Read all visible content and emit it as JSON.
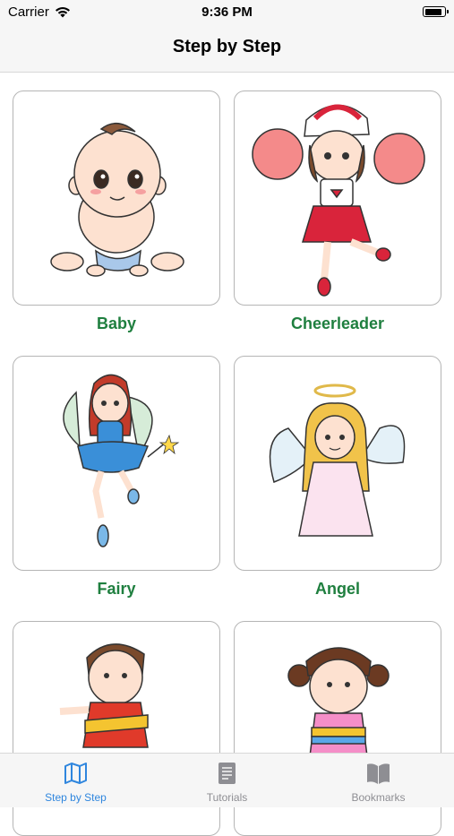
{
  "status_bar": {
    "carrier": "Carrier",
    "time": "9:36 PM",
    "battery_level": 0.9
  },
  "nav": {
    "title": "Step by Step"
  },
  "grid": {
    "items": [
      {
        "label": "Baby",
        "icon": "baby-drawing"
      },
      {
        "label": "Cheerleader",
        "icon": "cheerleader-drawing"
      },
      {
        "label": "Fairy",
        "icon": "fairy-drawing"
      },
      {
        "label": "Angel",
        "icon": "angel-drawing"
      },
      {
        "label": "",
        "icon": "boy-drawing"
      },
      {
        "label": "",
        "icon": "girl-drawing"
      }
    ]
  },
  "tab_bar": {
    "tabs": [
      {
        "label": "Step by Step",
        "icon": "map-icon",
        "active": true
      },
      {
        "label": "Tutorials",
        "icon": "document-icon",
        "active": false
      },
      {
        "label": "Bookmarks",
        "icon": "book-icon",
        "active": false
      }
    ]
  },
  "colors": {
    "accent": "#2f86de",
    "label_green": "#1f7f3f",
    "inactive": "#8e8e93"
  }
}
